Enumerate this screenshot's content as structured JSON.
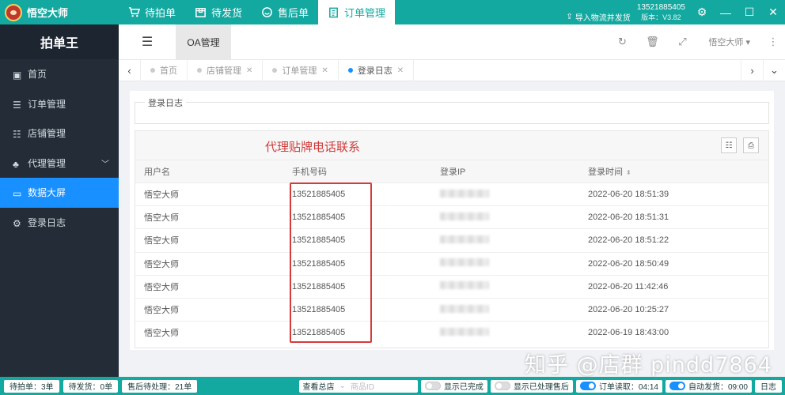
{
  "app": {
    "title": "悟空大师"
  },
  "toptabs": [
    {
      "label": "待拍单",
      "icon": "cart-icon"
    },
    {
      "label": "待发货",
      "icon": "package-icon"
    },
    {
      "label": "售后单",
      "icon": "service-icon"
    },
    {
      "label": "订单管理",
      "icon": "clipboard-icon",
      "active": true
    }
  ],
  "topright": {
    "import_label": "导入物流并发货",
    "phone": "13521885405",
    "version": "版本：V3.82"
  },
  "sidebar": {
    "brand": "拍单王",
    "items": [
      {
        "label": "首页",
        "icon": "home-icon"
      },
      {
        "label": "订单管理",
        "icon": "list-icon"
      },
      {
        "label": "店铺管理",
        "icon": "grid-icon"
      },
      {
        "label": "代理管理",
        "icon": "sitemap-icon",
        "has_children": true
      },
      {
        "label": "数据大屏",
        "icon": "monitor-icon",
        "active": true
      },
      {
        "label": "登录日志",
        "icon": "gear-icon"
      }
    ]
  },
  "header": {
    "title": "OA管理",
    "user": "悟空大师"
  },
  "pagetabs": [
    {
      "label": "首页",
      "closable": false
    },
    {
      "label": "店铺管理",
      "closable": true
    },
    {
      "label": "订单管理",
      "closable": true
    },
    {
      "label": "登录日志",
      "closable": true,
      "active": true
    }
  ],
  "panel": {
    "legend": "登录日志",
    "promo": "代理贴牌电话联系"
  },
  "table": {
    "columns": [
      "用户名",
      "手机号码",
      "登录IP",
      "登录时间"
    ],
    "rows": [
      {
        "user": "悟空大师",
        "phone": "13521885405",
        "time": "2022-06-20 18:51:39"
      },
      {
        "user": "悟空大师",
        "phone": "13521885405",
        "time": "2022-06-20 18:51:31"
      },
      {
        "user": "悟空大师",
        "phone": "13521885405",
        "time": "2022-06-20 18:51:22"
      },
      {
        "user": "悟空大师",
        "phone": "13521885405",
        "time": "2022-06-20 18:50:49"
      },
      {
        "user": "悟空大师",
        "phone": "13521885405",
        "time": "2022-06-20 11:42:46"
      },
      {
        "user": "悟空大师",
        "phone": "13521885405",
        "time": "2022-06-20 10:25:27"
      },
      {
        "user": "悟空大师",
        "phone": "13521885405",
        "time": "2022-06-19 18:43:00"
      }
    ]
  },
  "watermark": "知乎 @店群 pindd7864",
  "statusbar": {
    "pending_order": "待拍单：3单",
    "pending_ship": "待发货：0单",
    "aftersale": "售后待处理：21单",
    "view_shop": "查看总店",
    "product_placeholder": "商品ID",
    "show_done": "显示已完成",
    "show_processed": "显示已处理售后",
    "order_read": "订单读取：04:14",
    "auto_ship": "自动发货：09:00",
    "log": "日志"
  }
}
